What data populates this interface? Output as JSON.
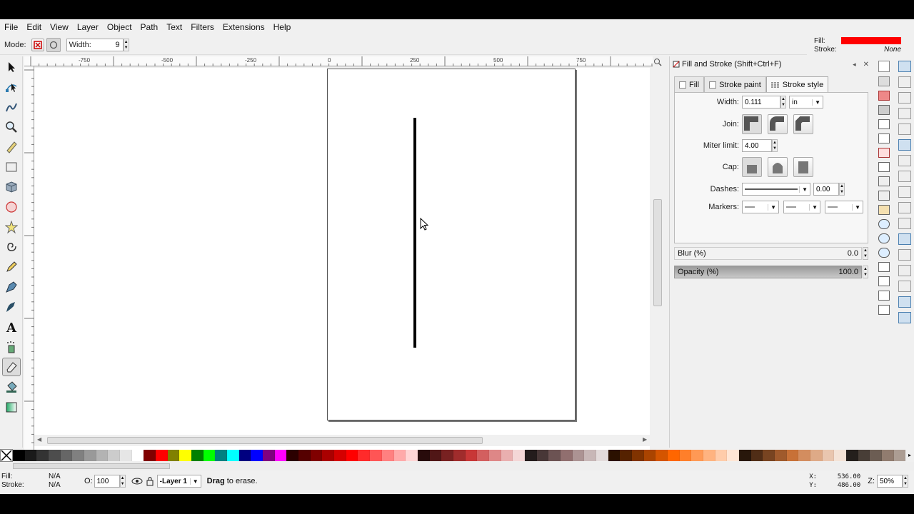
{
  "menu": [
    "File",
    "Edit",
    "View",
    "Layer",
    "Object",
    "Path",
    "Text",
    "Filters",
    "Extensions",
    "Help"
  ],
  "toolctrl": {
    "mode_label": "Mode:",
    "width_label": "Width:",
    "width_value": "9"
  },
  "fill_indicator": {
    "fill_label": "Fill:",
    "stroke_label": "Stroke:",
    "stroke_value": "None",
    "fill_color": "#ff0000"
  },
  "ruler": {
    "labels": [
      "-750",
      "-500",
      "-250",
      "0",
      "250",
      "500",
      "750"
    ]
  },
  "dialog": {
    "title": "Fill and Stroke (Shift+Ctrl+F)",
    "tabs": [
      "Fill",
      "Stroke paint",
      "Stroke style"
    ],
    "width_label": "Width:",
    "width_value": "0.111",
    "unit": "in",
    "join_label": "Join:",
    "miter_label": "Miter limit:",
    "miter_value": "4.00",
    "cap_label": "Cap:",
    "dashes_label": "Dashes:",
    "dash_offset": "0.00",
    "markers_label": "Markers:",
    "blur_label": "Blur (%)",
    "blur_value": "0.0",
    "opacity_label": "Opacity (%)",
    "opacity_value": "100.0"
  },
  "status": {
    "fill_label": "Fill:",
    "fill_value": "N/A",
    "stroke_label": "Stroke:",
    "stroke_value": "N/A",
    "o_label": "O:",
    "o_value": "100",
    "layer": "-Layer 1",
    "message_bold": "Drag",
    "message_rest": " to erase.",
    "x_label": "X:",
    "x_value": "536.00",
    "y_label": "Y:",
    "y_value": "486.00",
    "zoom_label": "Z:",
    "zoom_value": "50%"
  },
  "palette": [
    "#000000",
    "#1a1a1a",
    "#333333",
    "#4d4d4d",
    "#666666",
    "#808080",
    "#999999",
    "#b3b3b3",
    "#cccccc",
    "#e6e6e6",
    "#ffffff",
    "#800000",
    "#ff0000",
    "#808000",
    "#ffff00",
    "#008000",
    "#00ff00",
    "#008080",
    "#00ffff",
    "#000080",
    "#0000ff",
    "#800080",
    "#ff00ff",
    "#2b0000",
    "#550000",
    "#800000",
    "#aa0000",
    "#d40000",
    "#ff0000",
    "#ff2a2a",
    "#ff5555",
    "#ff8080",
    "#ffaaaa",
    "#ffd5d5",
    "#280b0b",
    "#501616",
    "#782121",
    "#a02c2c",
    "#c83737",
    "#d35f5f",
    "#de8787",
    "#e9afaf",
    "#f4d7d7",
    "#241c1c",
    "#483737",
    "#6c5353",
    "#916f6f",
    "#ac9393",
    "#c8b7b7",
    "#e3dbdb",
    "#2b1100",
    "#552200",
    "#803300",
    "#aa4400",
    "#d45500",
    "#ff6600",
    "#ff7f2a",
    "#ff9955",
    "#ffb380",
    "#ffccaa",
    "#ffe6d5",
    "#28170b",
    "#502d16",
    "#784421",
    "#a05a2c",
    "#c87137",
    "#d38d5f",
    "#deaa87",
    "#e9c6af",
    "#f4e3d7",
    "#241f1c",
    "#483e37",
    "#6c5d53",
    "#917c6f",
    "#ac9d93"
  ]
}
